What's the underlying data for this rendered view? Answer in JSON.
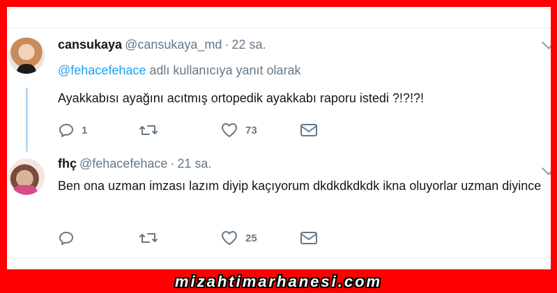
{
  "tweets": [
    {
      "display_name": "cansukaya",
      "handle": "@cansukaya_md",
      "separator": "·",
      "time": "22 sa.",
      "reply_to_mention": "@fehacefehace",
      "reply_to_suffix": "adlı kullanıcıya yanıt olarak",
      "text": "Ayakkabısı ayağını acıtmış ortopedik ayakkabı raporu istedi ?!?!?!",
      "reply_count": "1",
      "retweet_count": "",
      "like_count": "73"
    },
    {
      "display_name": "fhç",
      "handle": "@fehacefehace",
      "separator": "·",
      "time": "21 sa.",
      "text": "Ben ona uzman imzası lazım diyip kaçıyorum dkdkdkdkdk ikna oluyorlar uzman diyince",
      "reply_count": "",
      "retweet_count": "",
      "like_count": "25"
    }
  ],
  "watermark": "mizahtimarhanesi.com",
  "colors": {
    "frame": "#ff0000",
    "link": "#1da1f2",
    "muted": "#657786",
    "thread": "#b3d9f5"
  },
  "icons": [
    "reply-icon",
    "retweet-icon",
    "like-icon",
    "direct-message-icon",
    "more-options-icon"
  ]
}
